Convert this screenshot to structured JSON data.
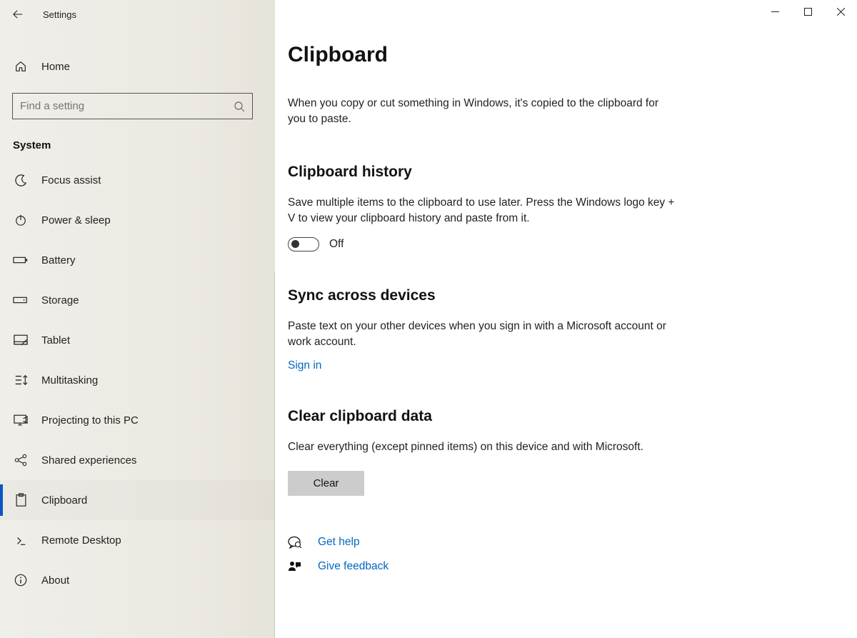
{
  "window": {
    "title": "Settings"
  },
  "sidebar": {
    "home_label": "Home",
    "search_placeholder": "Find a setting",
    "category_label": "System",
    "items": [
      {
        "label": "Focus assist",
        "icon": "moon"
      },
      {
        "label": "Power & sleep",
        "icon": "power"
      },
      {
        "label": "Battery",
        "icon": "battery"
      },
      {
        "label": "Storage",
        "icon": "storage"
      },
      {
        "label": "Tablet",
        "icon": "tablet"
      },
      {
        "label": "Multitasking",
        "icon": "multitask"
      },
      {
        "label": "Projecting to this PC",
        "icon": "project"
      },
      {
        "label": "Shared experiences",
        "icon": "shared"
      },
      {
        "label": "Clipboard",
        "icon": "clipboard"
      },
      {
        "label": "Remote Desktop",
        "icon": "remote"
      },
      {
        "label": "About",
        "icon": "about"
      }
    ],
    "selected_index": 8
  },
  "page": {
    "title": "Clipboard",
    "lead": "When you copy or cut something in Windows, it's copied to the clipboard for you to paste."
  },
  "history": {
    "title": "Clipboard history",
    "description": "Save multiple items to the clipboard to use later. Press the Windows logo key + V to view your clipboard history and paste from it.",
    "toggle_state": "Off"
  },
  "sync": {
    "title": "Sync across devices",
    "description": "Paste text on your other devices when you sign in with a Microsoft account or work account.",
    "signin_label": "Sign in"
  },
  "clear": {
    "title": "Clear clipboard data",
    "description": "Clear everything (except pinned items) on this device and with Microsoft.",
    "button_label": "Clear"
  },
  "footer": {
    "get_help": "Get help",
    "feedback": "Give feedback"
  }
}
